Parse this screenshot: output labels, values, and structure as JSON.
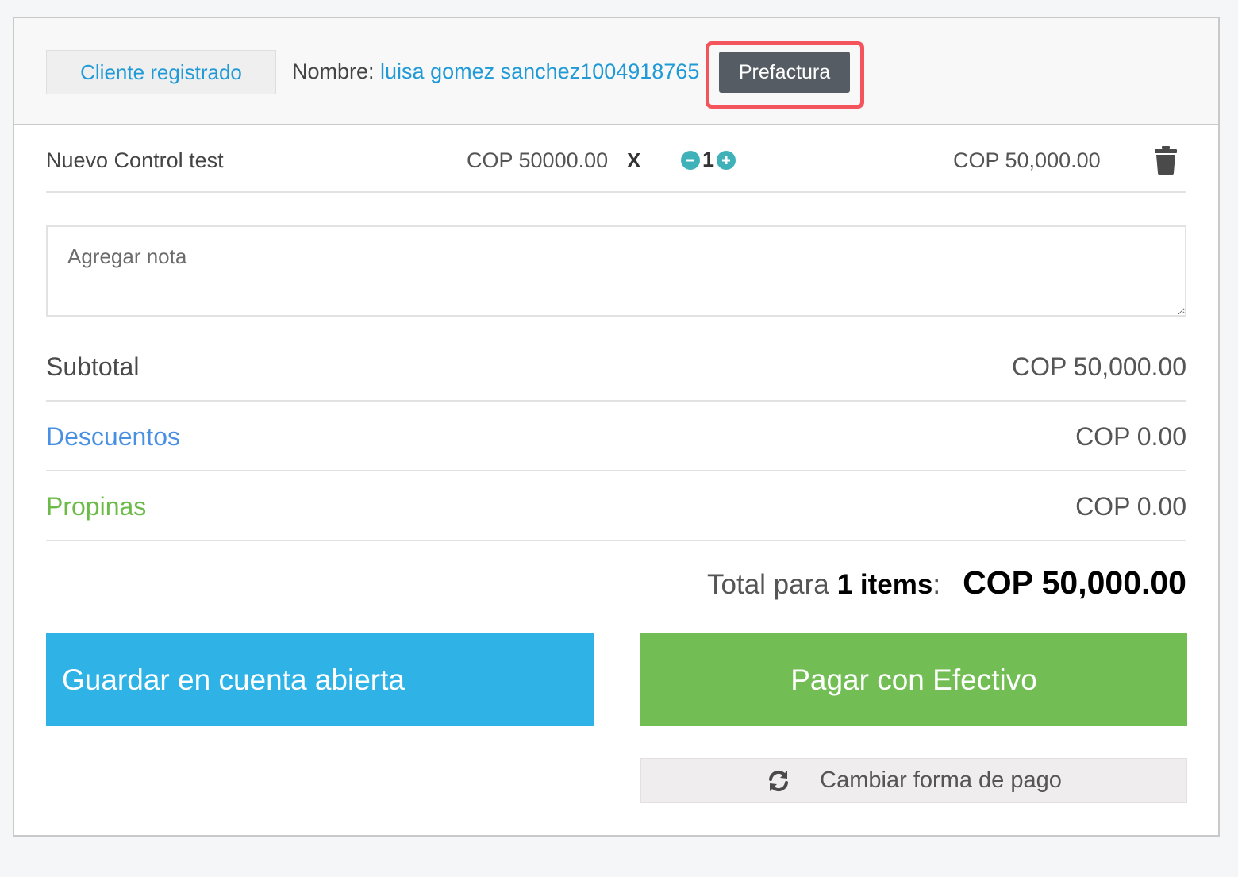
{
  "header": {
    "client_button": "Cliente registrado",
    "name_label": "Nombre:",
    "name_value": "luisa gomez sanchez1004918765",
    "prefactura_button": "Prefactura"
  },
  "item": {
    "name": "Nuevo Control test",
    "unit_price": "COP 50000.00",
    "multiplier": "X",
    "quantity": "1",
    "line_total": "COP 50,000.00"
  },
  "note": {
    "placeholder": "Agregar nota"
  },
  "summary": {
    "subtotal_label": "Subtotal",
    "subtotal_value": "COP 50,000.00",
    "discounts_label": "Descuentos",
    "discounts_value": "COP 0.00",
    "tips_label": "Propinas",
    "tips_value": "COP 0.00"
  },
  "total": {
    "label": "Total para",
    "count": "1 items",
    "colon": ":",
    "value": "COP 50,000.00"
  },
  "actions": {
    "open_account": "Guardar en cuenta abierta",
    "pay_cash": "Pagar con Efectivo",
    "change_payment": "Cambiar forma de pago"
  },
  "colors": {
    "accent_blue": "#2fb3e6",
    "accent_green": "#73bd55",
    "link_blue": "#1f9ad6",
    "highlight_red": "#f4545c"
  }
}
